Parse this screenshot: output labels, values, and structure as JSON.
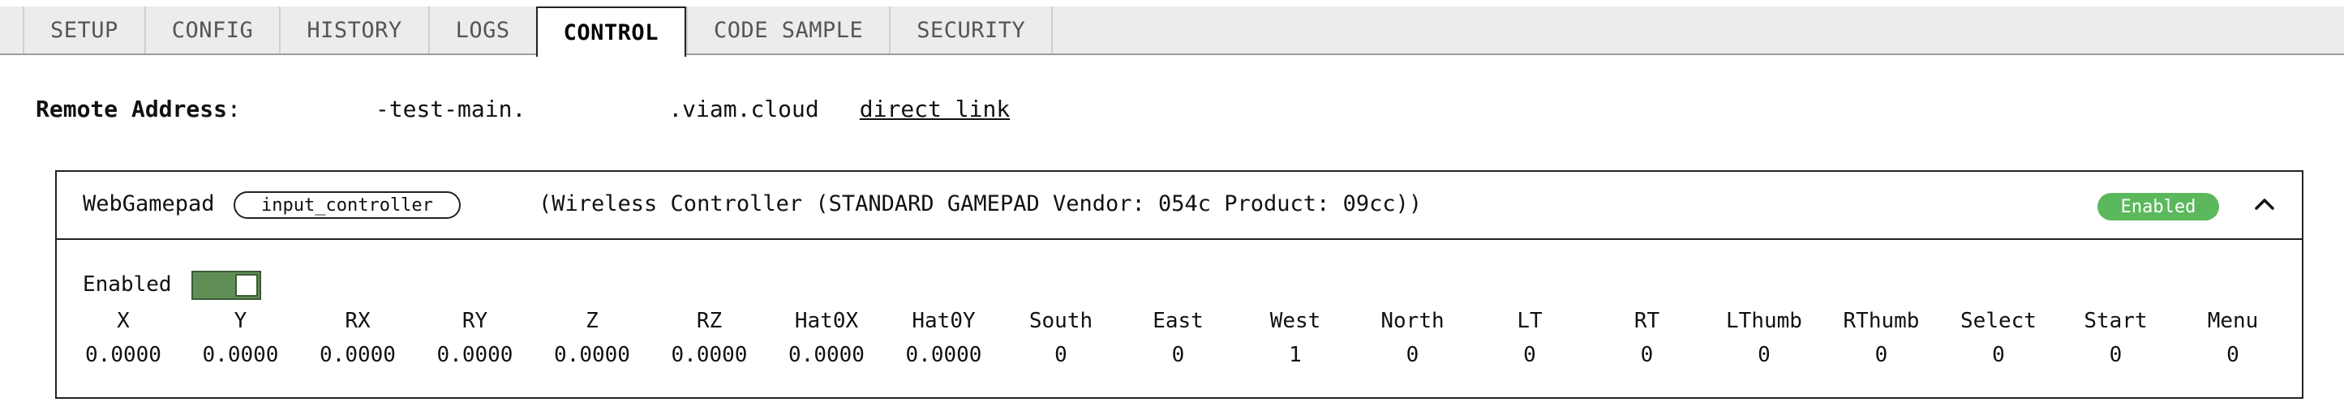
{
  "tabs": [
    {
      "label": "SETUP",
      "active": false
    },
    {
      "label": "CONFIG",
      "active": false
    },
    {
      "label": "HISTORY",
      "active": false
    },
    {
      "label": "LOGS",
      "active": false
    },
    {
      "label": "CONTROL",
      "active": true
    },
    {
      "label": "CODE SAMPLE",
      "active": false
    },
    {
      "label": "SECURITY",
      "active": false
    }
  ],
  "remote": {
    "label": "Remote Address",
    "colon": ":",
    "host_part_1": "-test-main.",
    "host_part_2": ".viam.cloud",
    "link_label": "direct link"
  },
  "component": {
    "name": "WebGamepad",
    "type": "input_controller",
    "description": "(Wireless Controller (STANDARD GAMEPAD Vendor: 054c Product: 09cc))",
    "status": "Enabled",
    "status_color": "#5cb85c",
    "enabled_label": "Enabled",
    "enabled": true,
    "columns": [
      "X",
      "Y",
      "RX",
      "RY",
      "Z",
      "RZ",
      "Hat0X",
      "Hat0Y",
      "South",
      "East",
      "West",
      "North",
      "LT",
      "RT",
      "LThumb",
      "RThumb",
      "Select",
      "Start",
      "Menu"
    ],
    "values": [
      "0.0000",
      "0.0000",
      "0.0000",
      "0.0000",
      "0.0000",
      "0.0000",
      "0.0000",
      "0.0000",
      "0",
      "0",
      "1",
      "0",
      "0",
      "0",
      "0",
      "0",
      "0",
      "0",
      "0"
    ]
  }
}
